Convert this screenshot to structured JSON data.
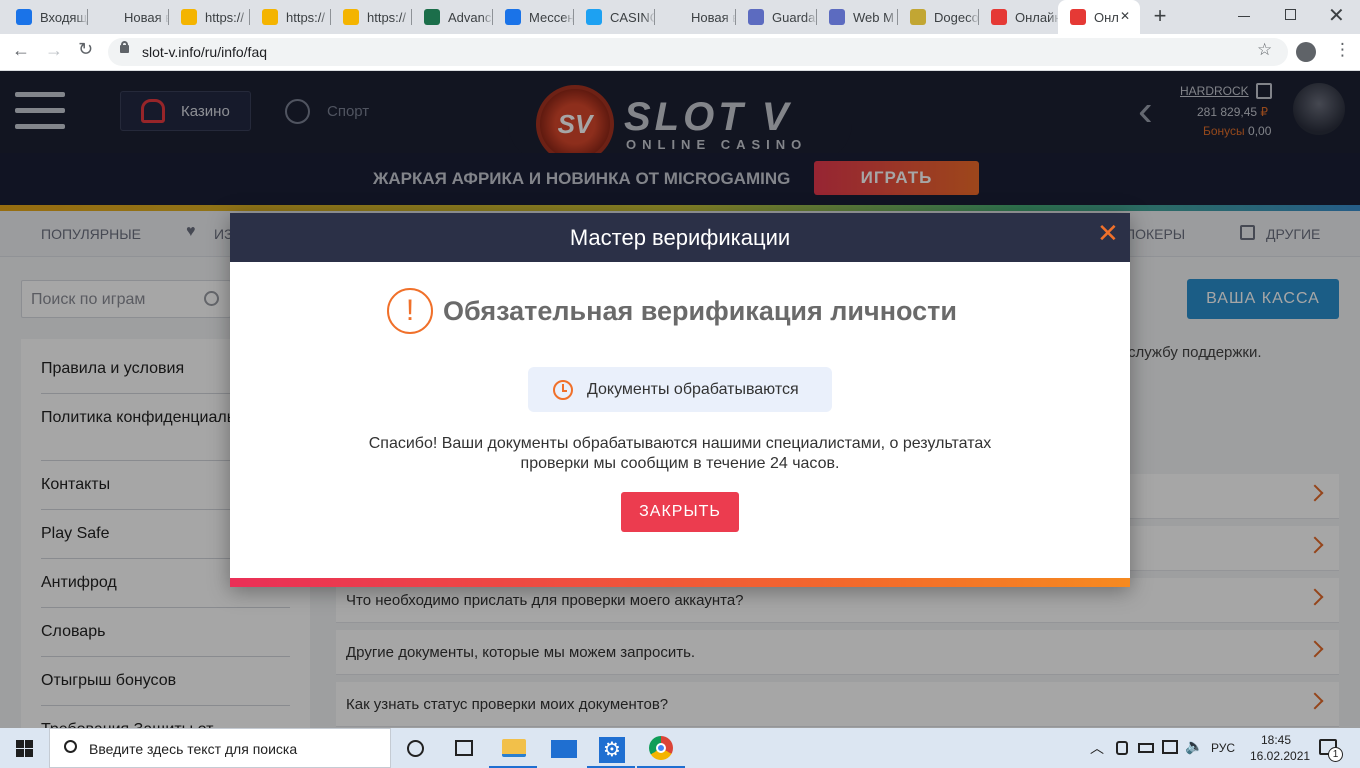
{
  "browser": {
    "tabs": [
      {
        "title": "Входящ",
        "icon": "gmail-icon",
        "color": "#1a73e8"
      },
      {
        "title": "Новая вкла",
        "icon": "none",
        "color": ""
      },
      {
        "title": "https://",
        "icon": "windows-tiles-icon",
        "color": "#f4b400"
      },
      {
        "title": "https://",
        "icon": "windows-tiles-icon",
        "color": "#f4b400"
      },
      {
        "title": "https://",
        "icon": "windows-tiles-icon",
        "color": "#f4b400"
      },
      {
        "title": "Advanc",
        "icon": "star-icon",
        "color": "#1b6e4a"
      },
      {
        "title": "Мессен",
        "icon": "chat-icon",
        "color": "#1a73e8"
      },
      {
        "title": "CASINC",
        "icon": "twitter-icon",
        "color": "#1da1f2"
      },
      {
        "title": "Новая вкла",
        "icon": "none",
        "color": ""
      },
      {
        "title": "Guarda",
        "icon": "shield-icon",
        "color": "#5c6bc0"
      },
      {
        "title": "Web M",
        "icon": "shield-icon",
        "color": "#5c6bc0"
      },
      {
        "title": "Dogeco",
        "icon": "dogecoin-icon",
        "color": "#c2a633"
      },
      {
        "title": "Онлайн",
        "icon": "slotv-icon",
        "color": "#e53935"
      },
      {
        "title": "Онл",
        "icon": "slotv-icon",
        "color": "#e53935"
      }
    ],
    "new_tab_symbol": "+",
    "address": "slot-v.info/ru/info/faq"
  },
  "site": {
    "nav": {
      "casino_label": "Казино",
      "sport_label": "Спорт"
    },
    "logo": {
      "main": "SLOT V",
      "sub": "ONLINE CASINO",
      "badge": "SV"
    },
    "user": {
      "name": "HARDROCK",
      "balance": "281 829,45",
      "currency": "₽",
      "bonus_label": "Бонусы",
      "bonus_value": "0,00"
    },
    "promo": {
      "text": "ЖАРКАЯ АФРИКА И НОВИНКА ОТ MICROGAMING",
      "button": "ИГРАТЬ"
    },
    "categories": {
      "popular": "ПОПУЛЯРНЫЕ",
      "favorites": "ИЗ",
      "pokers": "ПОКЕРЫ",
      "others": "ДРУГИЕ"
    },
    "search_placeholder": "Поиск по играм",
    "cashier_button": "ВАША КАССА",
    "support_text": "службу поддержки.",
    "sidebar": [
      "Правила и условия",
      "Политика конфиденциальности",
      "Контакты",
      "Play Safe",
      "Антифрод",
      "Словарь",
      "Отыгрыш бонусов",
      "Требования Защиты от"
    ],
    "faq": [
      "Что необходимо прислать для проверки моего аккаунта?",
      "Другие документы, которые мы можем запросить.",
      "Как узнать статус проверки моих документов?"
    ]
  },
  "modal": {
    "title": "Мастер верификации",
    "heading": "Обязательная верификация личности",
    "status": "Документы обрабатываются",
    "message_line1": "Спасибо! Ваши документы обрабатываются нашими специалистами, о результатах",
    "message_line2": "проверки мы сообщим в течение 24 часов.",
    "close_button": "ЗАКРЫТЬ"
  },
  "taskbar": {
    "search_placeholder": "Введите здесь текст для поиска",
    "lang": "РУС",
    "time": "18:45",
    "date": "16.02.2021",
    "notifications": "1"
  },
  "colors": {
    "accent": "#f0702a",
    "danger": "#ec3c4f",
    "header": "#1e2338"
  }
}
